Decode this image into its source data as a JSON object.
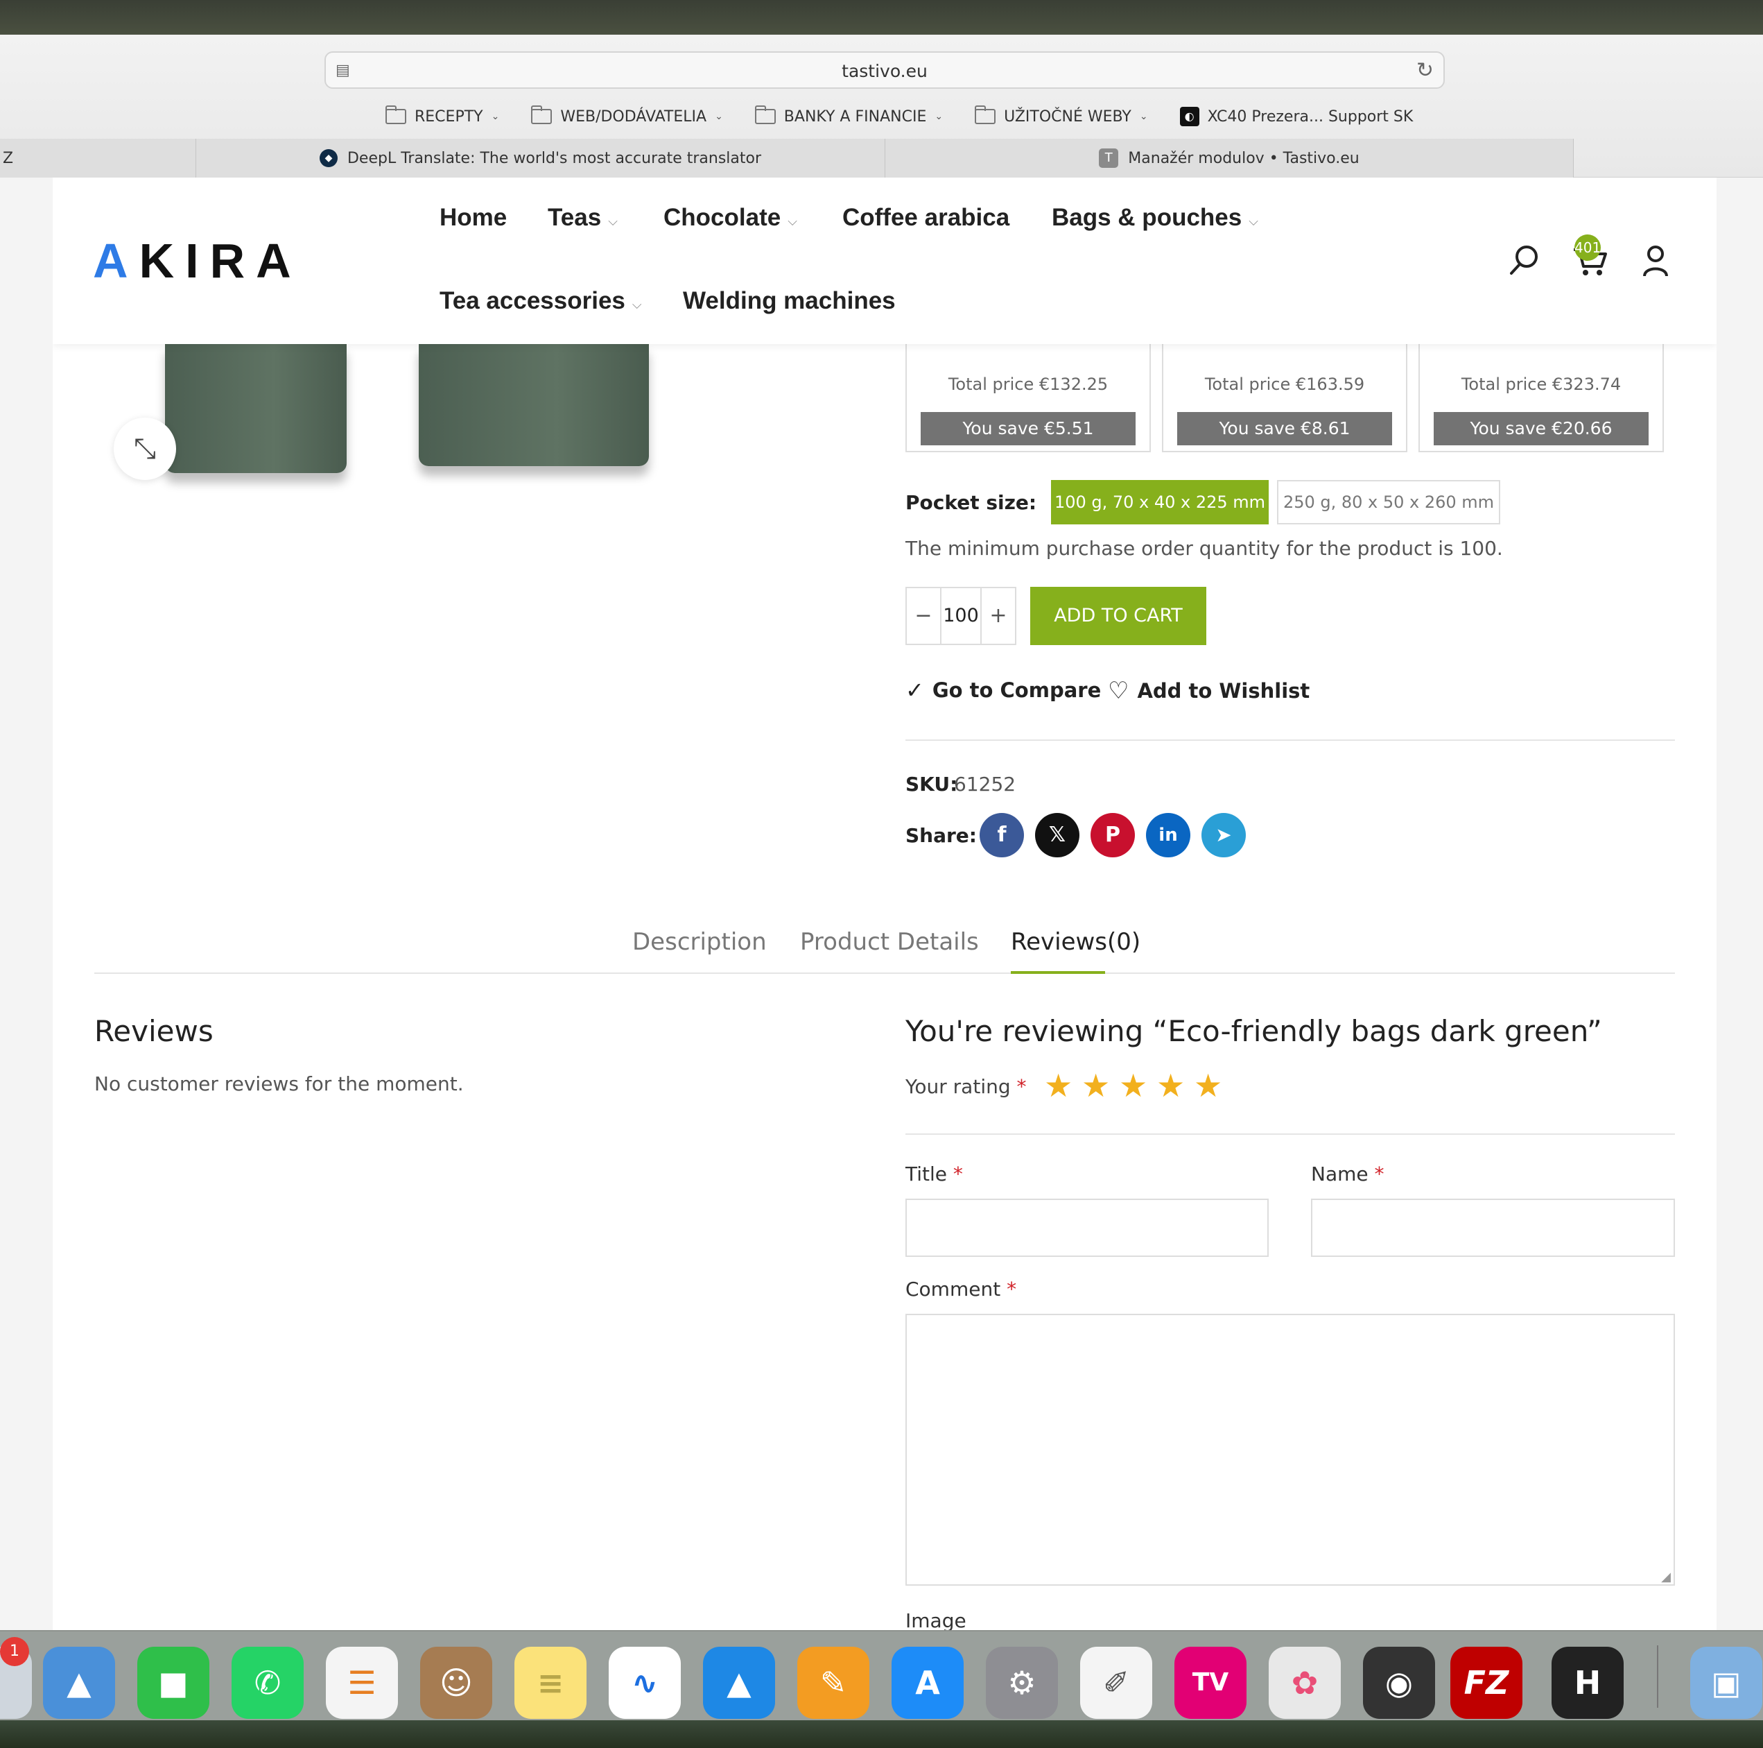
{
  "browser": {
    "url": "tastivo.eu",
    "bookmarks": [
      {
        "label": "RECEPTY",
        "icon": "folder-icon"
      },
      {
        "label": "WEB/DODÁVATELIA",
        "icon": "folder-icon"
      },
      {
        "label": "BANKY A FINANCIE",
        "icon": "folder-icon"
      },
      {
        "label": "UŽITOČNÉ WEBY",
        "icon": "folder-icon"
      },
      {
        "label": "XC40 Prezera... Support SK",
        "icon": "xc-icon"
      }
    ],
    "tabs": [
      {
        "label": "Z"
      },
      {
        "label": "DeepL Translate: The world's most accurate translator"
      },
      {
        "label": "Manažér modulov • Tastivo.eu"
      }
    ]
  },
  "header": {
    "logo": "AKIRA",
    "nav": [
      {
        "label": "Home",
        "dropdown": false
      },
      {
        "label": "Teas",
        "dropdown": true
      },
      {
        "label": "Chocolate",
        "dropdown": true
      },
      {
        "label": "Coffee arabica",
        "dropdown": false
      },
      {
        "label": "Bags & pouches",
        "dropdown": true
      },
      {
        "label": "Tea accessories",
        "dropdown": true
      },
      {
        "label": "Welding machines",
        "dropdown": false
      }
    ],
    "cart_count": "401",
    "icons": [
      "search-icon",
      "cart-icon",
      "user-icon"
    ]
  },
  "tiers": [
    {
      "total": "Total price €132.25",
      "save": "You save €5.51"
    },
    {
      "total": "Total price €163.59",
      "save": "You save €8.61"
    },
    {
      "total": "Total price €323.74",
      "save": "You save €20.66"
    }
  ],
  "product": {
    "pocket_label": "Pocket size:",
    "options": [
      {
        "label": "100 g, 70 x 40 x 225 mm",
        "selected": true
      },
      {
        "label": "250 g, 80 x 50 x 260 mm",
        "selected": false
      }
    ],
    "min_qty_text": "The minimum purchase order quantity for the product is 100.",
    "qty": "100",
    "qty_minus": "−",
    "qty_plus": "+",
    "add_to_cart": "ADD TO CART",
    "compare": "Go to Compare",
    "wishlist": "Add to Wishlist",
    "sku_label": "SKU:",
    "sku": "61252",
    "share_label": "Share:",
    "share": [
      {
        "name": "facebook",
        "glyph": "f",
        "color": "#3b5998"
      },
      {
        "name": "x",
        "glyph": "𝕏",
        "color": "#111111"
      },
      {
        "name": "pinterest",
        "glyph": "P",
        "color": "#c8102e"
      },
      {
        "name": "linkedin",
        "glyph": "in",
        "color": "#0a66c2"
      },
      {
        "name": "telegram",
        "glyph": "➤",
        "color": "#2a9fd6"
      }
    ]
  },
  "tabs": [
    {
      "label": "Description",
      "active": false
    },
    {
      "label": "Product Details",
      "active": false
    },
    {
      "label": "Reviews(0)",
      "active": true
    }
  ],
  "reviews": {
    "title": "Reviews",
    "empty": "No customer reviews for the moment.",
    "form_title": "You're reviewing “Eco-friendly bags dark green”",
    "rating_label": "Your rating",
    "stars": 5,
    "title_label": "Title",
    "name_label": "Name",
    "comment_label": "Comment",
    "image_label": "Image",
    "required": "*"
  },
  "dock": {
    "badge": "1",
    "apps": [
      {
        "name": "maps-app",
        "glyph": "▲",
        "color": "#4a90d9"
      },
      {
        "name": "facetime-app",
        "glyph": "■",
        "color": "#2fbf4a"
      },
      {
        "name": "whatsapp-app",
        "glyph": "✆",
        "color": "#25d366"
      },
      {
        "name": "reminders-app",
        "glyph": "☰",
        "color": "#f4f4f4"
      },
      {
        "name": "contacts-app",
        "glyph": "☺",
        "color": "#a67c52"
      },
      {
        "name": "notes-app",
        "glyph": "≡",
        "color": "#fbe27a"
      },
      {
        "name": "freeform-app",
        "glyph": "∿",
        "color": "#ffffff"
      },
      {
        "name": "keynote-app",
        "glyph": "▲",
        "color": "#1e88e5"
      },
      {
        "name": "pages-app",
        "glyph": "✎",
        "color": "#f39c22"
      },
      {
        "name": "appstore-app",
        "glyph": "A",
        "color": "#1d8cf8"
      },
      {
        "name": "settings-app",
        "glyph": "⚙",
        "color": "#8e8e93"
      },
      {
        "name": "textedit-app",
        "glyph": "✐",
        "color": "#f4f4f4"
      },
      {
        "name": "magiotv-app",
        "glyph": "TV",
        "color": "#e20074"
      },
      {
        "name": "pixelmator-app",
        "glyph": "✿",
        "color": "#e8e8e8"
      },
      {
        "name": "imagecapture-app",
        "glyph": "◉",
        "color": "#333333"
      },
      {
        "name": "filezilla-app",
        "glyph": "FZ",
        "color": "#bf0000"
      },
      {
        "name": "h-app",
        "glyph": "H",
        "color": "#222222"
      },
      {
        "name": "preview-app",
        "glyph": "▣",
        "color": "#7fb0e0"
      }
    ]
  }
}
